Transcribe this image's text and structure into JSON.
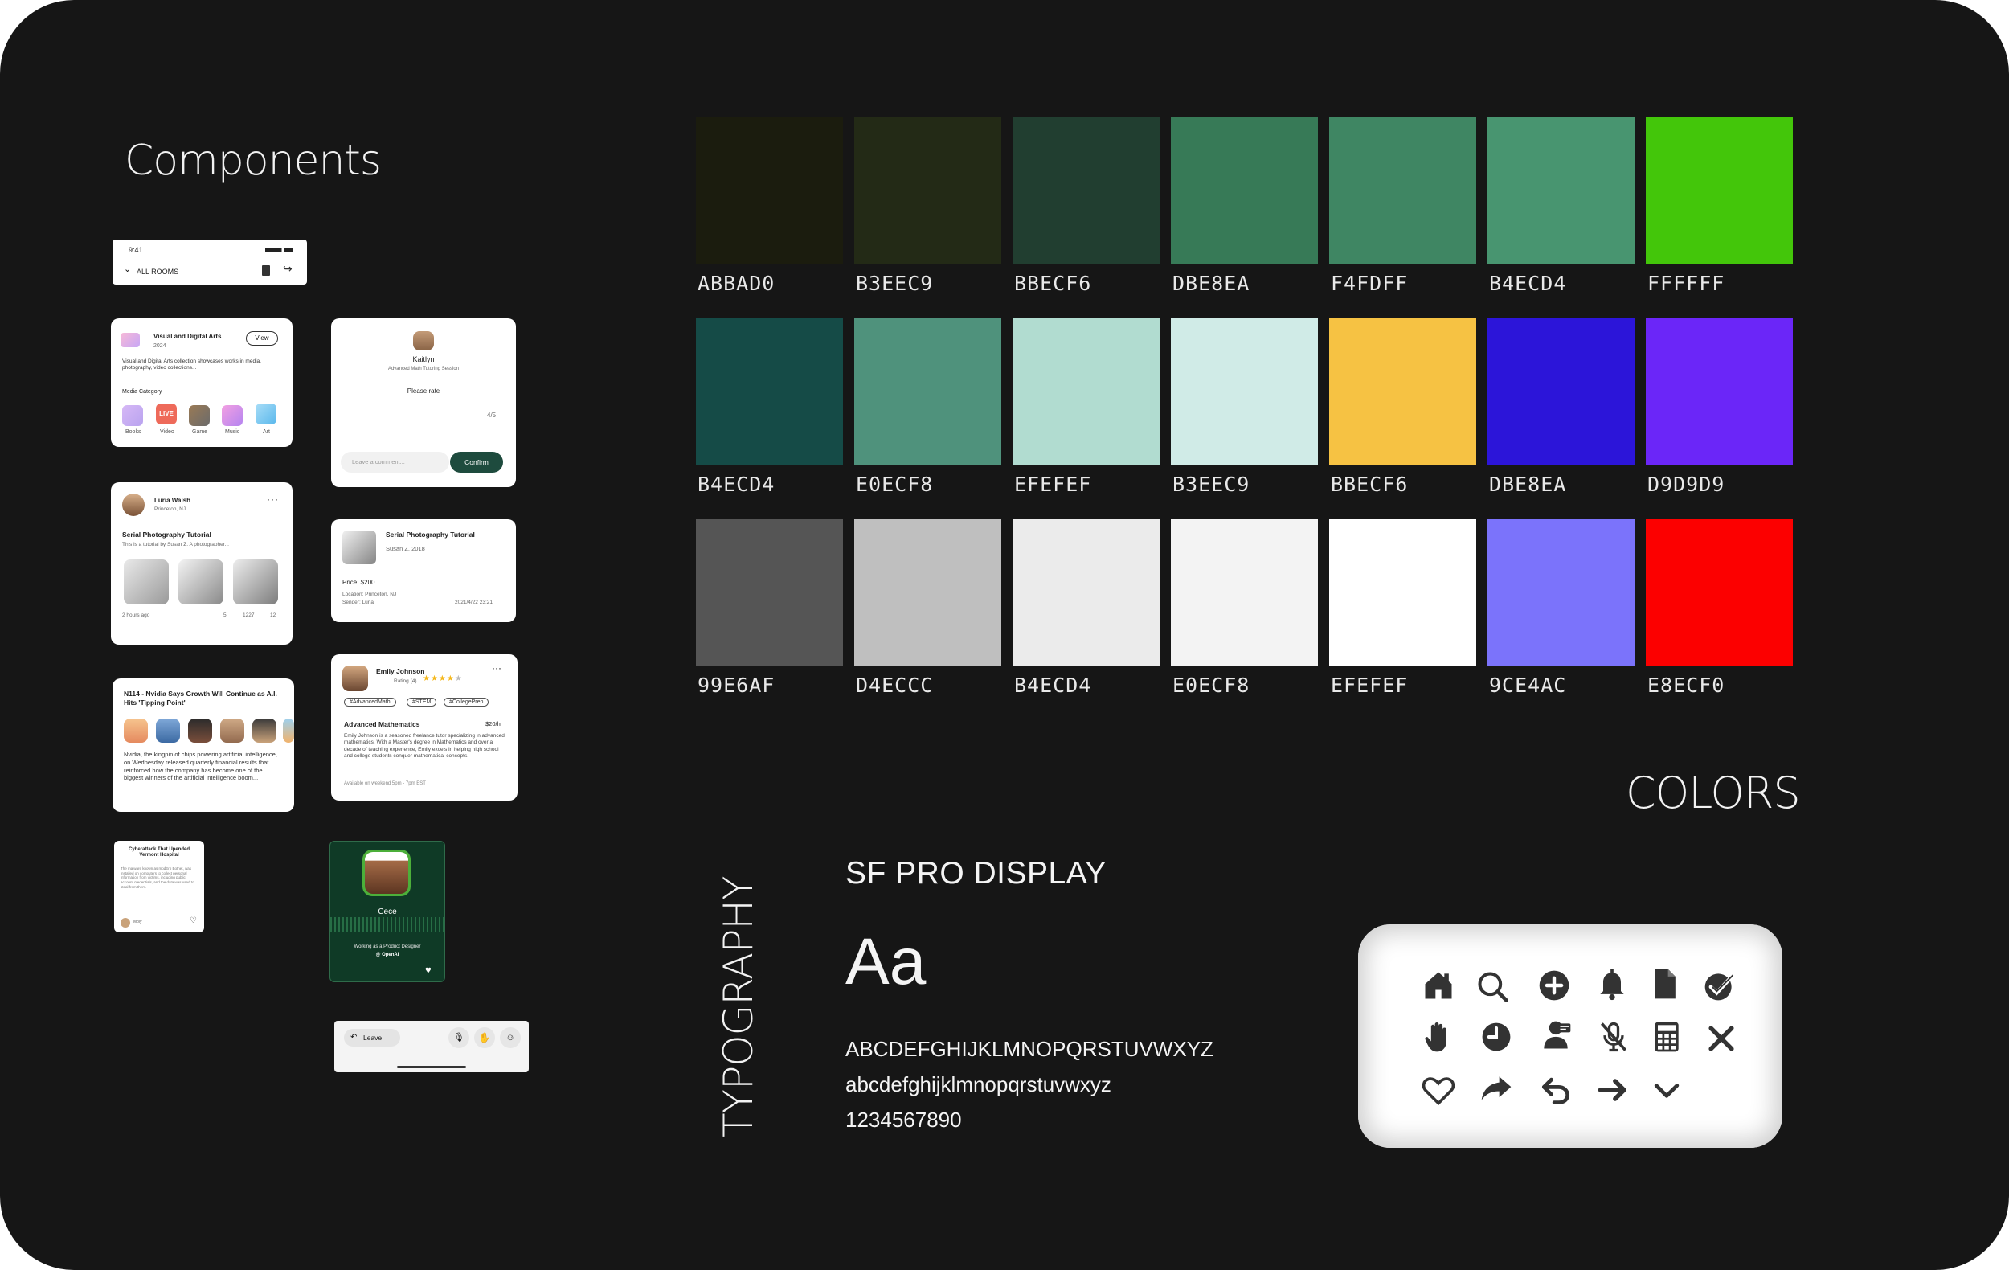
{
  "headings": {
    "components": "Components",
    "colors": "COLORS",
    "typography": "TYPOGRAPHY"
  },
  "status_bar": {
    "time": "9:41",
    "rooms_label": "ALL ROOMS"
  },
  "arts_card": {
    "title": "Visual and Digital Arts",
    "year": "2024",
    "view_button": "View",
    "description": "Visual and Digital Arts collection showcases works in media, photography, video collections...",
    "category_label": "Media Category",
    "categories": [
      "Books",
      "Video",
      "Game",
      "Music",
      "Art"
    ],
    "live_badge": "LIVE"
  },
  "rating_card": {
    "name": "Kaitlyn",
    "subtitle": "Advanced Math Tutoring Session",
    "prompt": "Please rate",
    "score": "4/5",
    "comment_placeholder": "Leave a comment...",
    "confirm_button": "Confirm",
    "stars_filled": 4,
    "stars_total": 5
  },
  "photo_post": {
    "author": "Luria Walsh",
    "location": "Princeton, NJ",
    "title": "Serial Photography Tutorial",
    "body": "This is a tutorial by Susan Z. A photographer...",
    "time": "2 hours ago",
    "likes": "5",
    "views": "1227",
    "comments": "12"
  },
  "listing_card": {
    "title": "Serial Photography Tutorial",
    "author": "Susan Z, 2018",
    "price": "Price: $200",
    "location": "Location: Princeton, NJ",
    "sender": "Sender: Luria",
    "date": "2021/4/22 23:21"
  },
  "news_card": {
    "title": "N114 - Nvidia Says Growth Will Continue as A.I. Hits 'Tipping Point'",
    "body": "Nvidia, the kingpin of chips powering artificial intelligence, on Wednesday released quarterly financial results that reinforced how the company has become one of the biggest winners of the artificial intelligence boom..."
  },
  "tutor_card": {
    "name": "Emily Johnson",
    "rating_label": "Rating (4)",
    "tags": [
      "#AdvancedMath",
      "#STEM",
      "#CollegePrep"
    ],
    "subject": "Advanced Mathematics",
    "rate": "$20/h",
    "body": "Emily Johnson is a seasoned freelance tutor specializing in advanced mathematics. With a Master's degree in Mathematics and over a decade of teaching experience, Emily excels in helping high school and college students conquer mathematical concepts.",
    "availability": "Available on weekend 5pm - 7pm EST"
  },
  "mini_news": {
    "title": "Cyberattack That Upended Vermont Hospital",
    "body": "The malware known as modErp Botnet, was installed on computers to collect personal information from victims, including public account credentials, and the data was used to steal from them.",
    "author": "Moly"
  },
  "profile_card": {
    "name": "Cece",
    "role": "Working as a Product Designer",
    "company": "@ OpenAI"
  },
  "call_bar": {
    "leave_button": "Leave"
  },
  "palette": [
    {
      "label": "ABBAD0",
      "color": "#1b1c0e"
    },
    {
      "label": "B3EEC9",
      "color": "#232a16"
    },
    {
      "label": "BBECF6",
      "color": "#213e30"
    },
    {
      "label": "DBE8EA",
      "color": "#377a57"
    },
    {
      "label": "F4FDFF",
      "color": "#3f8663"
    },
    {
      "label": "B4ECD4",
      "color": "#489570"
    },
    {
      "label": "FFFFFF",
      "color": "#43c60a"
    },
    {
      "label": "B4ECD4",
      "color": "#154b47"
    },
    {
      "label": "E0ECF8",
      "color": "#4f927c"
    },
    {
      "label": "EFEFEF",
      "color": "#b1dcd0"
    },
    {
      "label": "B3EEC9",
      "color": "#d0ebe7"
    },
    {
      "label": "BBECF6",
      "color": "#f6c243"
    },
    {
      "label": "DBE8EA",
      "color": "#2c15d9"
    },
    {
      "label": "D9D9D9",
      "color": "#6b26f8"
    },
    {
      "label": "99E6AF",
      "color": "#555555"
    },
    {
      "label": "D4ECCC",
      "color": "#bfbfbf"
    },
    {
      "label": "B4ECD4",
      "color": "#ebebeb"
    },
    {
      "label": "E0ECF8",
      "color": "#f3f3f3"
    },
    {
      "label": "EFEFEF",
      "color": "#ffffff"
    },
    {
      "label": "9CE4AC",
      "color": "#7b73fb"
    },
    {
      "label": "E8ECF0",
      "color": "#fc0000"
    }
  ],
  "typography": {
    "font_name": "SF PRO DISPLAY",
    "sample": "Aa",
    "uppercase": "ABCDEFGHIJKLMNOPQRSTUVWXYZ",
    "lowercase": "abcdefghijklmnopqrstuvwxyz",
    "digits": "1234567890"
  },
  "icons": [
    "home-icon",
    "search-icon",
    "add-circle-icon",
    "bell-icon",
    "document-icon",
    "check-circle-icon",
    "raise-hand-icon",
    "clock-icon",
    "speaker-icon",
    "mic-off-icon",
    "calculator-icon",
    "close-icon",
    "heart-icon",
    "share-icon",
    "undo-icon",
    "arrow-right-icon",
    "chevron-down-icon"
  ]
}
